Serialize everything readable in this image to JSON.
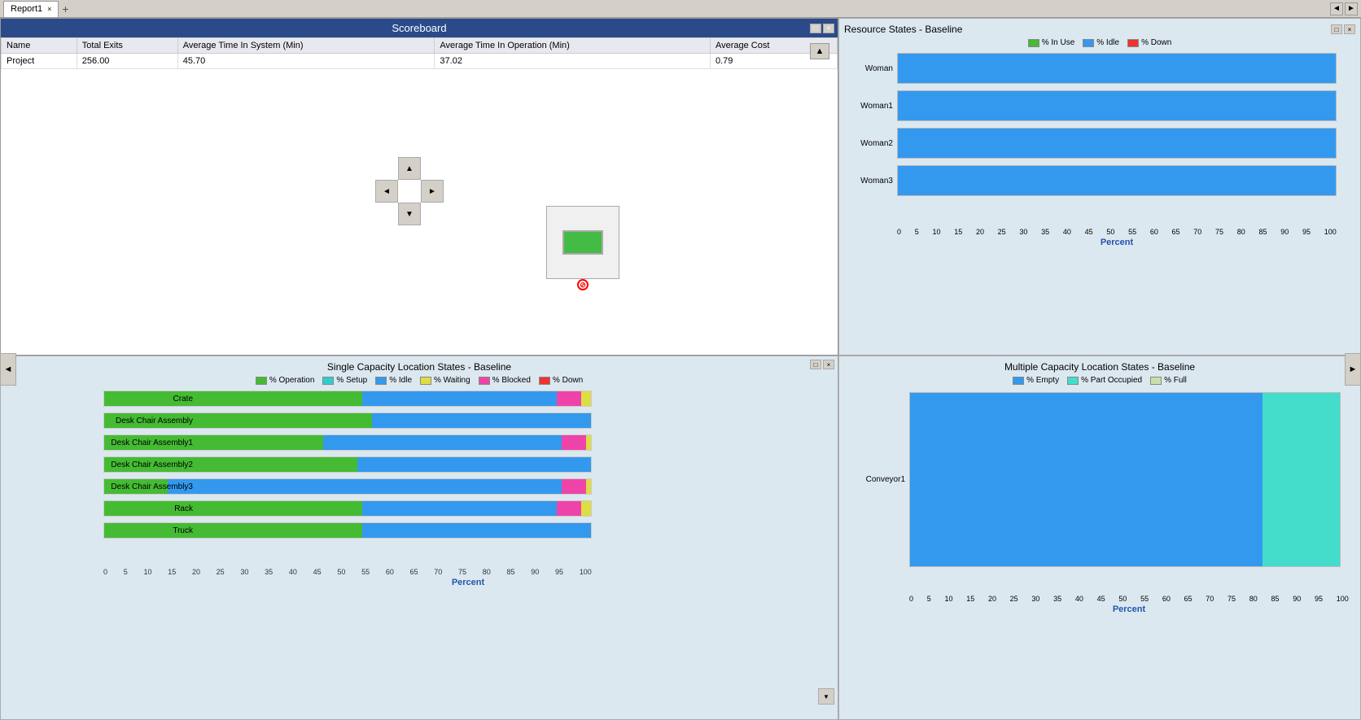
{
  "tabbar": {
    "tab1": "Report1",
    "add_tab": "+",
    "nav_left": "◄",
    "nav_right": "►"
  },
  "scoreboard": {
    "title": "Scoreboard",
    "columns": [
      "Name",
      "Total Exits",
      "Average Time In System (Min)",
      "Average Time In Operation (Min)",
      "Average Cost"
    ],
    "rows": [
      {
        "name": "Project",
        "total_exits": "256.00",
        "avg_time_system": "45.70",
        "avg_time_operation": "37.02",
        "avg_cost": "0.79"
      }
    ],
    "scroll_up": "▲",
    "win_minimize": "□",
    "win_close": "×"
  },
  "nav_cross": {
    "up": "▲",
    "left": "◄",
    "right": "►",
    "down": "▼"
  },
  "single_capacity": {
    "title": "Single Capacity Location States - Baseline",
    "win_minimize": "□",
    "win_close": "×",
    "legend": [
      {
        "label": "% Operation",
        "color": "#44bb33"
      },
      {
        "label": "% Setup",
        "color": "#33cccc"
      },
      {
        "label": "% Idle",
        "color": "#3399ee"
      },
      {
        "label": "% Waiting",
        "color": "#dddd44"
      },
      {
        "label": "% Blocked",
        "color": "#ee44aa"
      },
      {
        "label": "% Down",
        "color": "#ee3333"
      }
    ],
    "xlabel": "Percent",
    "axis_labels": [
      "0",
      "5",
      "10",
      "15",
      "20",
      "25",
      "30",
      "35",
      "40",
      "45",
      "50",
      "55",
      "60",
      "65",
      "70",
      "75",
      "80",
      "85",
      "90",
      "95",
      "100"
    ],
    "bars": [
      {
        "label": "Crate",
        "segments": [
          {
            "color": "#44bb33",
            "pct": 53
          },
          {
            "color": "#3399ee",
            "pct": 40
          },
          {
            "color": "#ee44aa",
            "pct": 5
          },
          {
            "color": "#dddd44",
            "pct": 2
          }
        ]
      },
      {
        "label": "Desk  Chair Assembly",
        "segments": [
          {
            "color": "#44bb33",
            "pct": 55
          },
          {
            "color": "#3399ee",
            "pct": 45
          }
        ]
      },
      {
        "label": "Desk  Chair Assembly1",
        "segments": [
          {
            "color": "#44bb33",
            "pct": 45
          },
          {
            "color": "#3399ee",
            "pct": 49
          },
          {
            "color": "#ee44aa",
            "pct": 5
          },
          {
            "color": "#dddd44",
            "pct": 1
          }
        ]
      },
      {
        "label": "Desk  Chair Assembly2",
        "segments": [
          {
            "color": "#44bb33",
            "pct": 52
          },
          {
            "color": "#3399ee",
            "pct": 48
          }
        ]
      },
      {
        "label": "Desk  Chair Assembly3",
        "segments": [
          {
            "color": "#44bb33",
            "pct": 13
          },
          {
            "color": "#3399ee",
            "pct": 81
          },
          {
            "color": "#ee44aa",
            "pct": 5
          },
          {
            "color": "#dddd44",
            "pct": 1
          }
        ]
      },
      {
        "label": "Rack",
        "segments": [
          {
            "color": "#44bb33",
            "pct": 53
          },
          {
            "color": "#3399ee",
            "pct": 40
          },
          {
            "color": "#ee44aa",
            "pct": 5
          },
          {
            "color": "#dddd44",
            "pct": 2
          }
        ]
      },
      {
        "label": "Truck",
        "segments": [
          {
            "color": "#44bb33",
            "pct": 53
          },
          {
            "color": "#3399ee",
            "pct": 47
          }
        ]
      }
    ],
    "scroll_down": "▼"
  },
  "resource_states": {
    "title": "Resource States - Baseline",
    "win_minimize": "□",
    "win_close": "×",
    "legend": [
      {
        "label": "% In Use",
        "color": "#44bb33"
      },
      {
        "label": "% Idle",
        "color": "#3399ee"
      },
      {
        "label": "% Down",
        "color": "#ee3333"
      }
    ],
    "xlabel": "Percent",
    "axis_labels": [
      "0",
      "5",
      "10",
      "15",
      "20",
      "25",
      "30",
      "35",
      "40",
      "45",
      "50",
      "55",
      "60",
      "65",
      "70",
      "75",
      "80",
      "85",
      "90",
      "95",
      "100"
    ],
    "bars": [
      {
        "label": "Woman",
        "segments": [
          {
            "color": "#3399ee",
            "pct": 100
          }
        ]
      },
      {
        "label": "Woman1",
        "segments": [
          {
            "color": "#3399ee",
            "pct": 100
          }
        ]
      },
      {
        "label": "Woman2",
        "segments": [
          {
            "color": "#3399ee",
            "pct": 100
          }
        ]
      },
      {
        "label": "Woman3",
        "segments": [
          {
            "color": "#3399ee",
            "pct": 100
          }
        ]
      }
    ]
  },
  "multiple_capacity": {
    "title": "Multiple Capacity Location States - Baseline",
    "legend": [
      {
        "label": "% Empty",
        "color": "#3399ee"
      },
      {
        "label": "% Part Occupied",
        "color": "#44ddcc"
      },
      {
        "label": "% Full",
        "color": "#ccddaa"
      }
    ],
    "xlabel": "Percent",
    "axis_labels": [
      "0",
      "5",
      "10",
      "15",
      "20",
      "25",
      "30",
      "35",
      "40",
      "45",
      "50",
      "55",
      "60",
      "65",
      "70",
      "75",
      "80",
      "85",
      "90",
      "95",
      "100"
    ],
    "bars": [
      {
        "label": "Conveyor1",
        "segments": [
          {
            "color": "#3399ee",
            "pct": 82
          },
          {
            "color": "#44ddcc",
            "pct": 18
          }
        ]
      }
    ]
  },
  "nav": {
    "left_arrow": "◄",
    "right_arrow": "►",
    "scroll_down": "▼"
  }
}
